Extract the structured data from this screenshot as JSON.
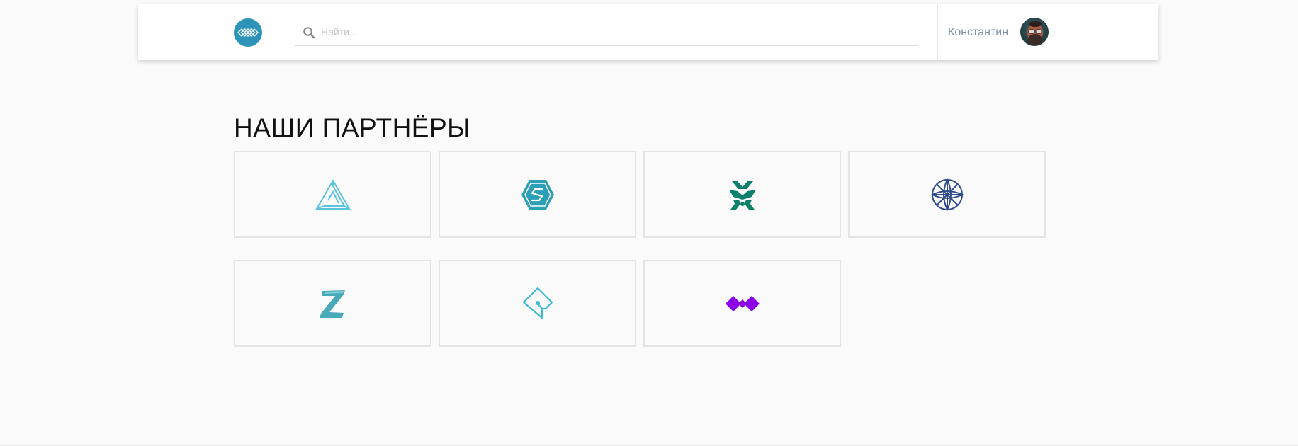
{
  "header": {
    "logo_icon": "diamonds-logo-icon",
    "search": {
      "placeholder": "Найти...",
      "value": "",
      "icon": "search-icon"
    },
    "user": {
      "name": "Константин",
      "avatar_icon": "user-avatar"
    }
  },
  "main": {
    "title": "НАШИ ПАРТНЁРЫ",
    "partners": [
      {
        "icon": "impossible-triangle-logo-icon",
        "color": "#5cc4dd"
      },
      {
        "icon": "hexagon-s-logo-icon",
        "color": "#2a9fb5"
      },
      {
        "icon": "tribal-figure-logo-icon",
        "color": "#0d7f6b"
      },
      {
        "icon": "circle-wheel-logo-icon",
        "color": "#2f4b8a"
      },
      {
        "icon": "letter-z-logo-icon",
        "color": "#48a9b8"
      },
      {
        "icon": "diamond-pin-logo-icon",
        "color": "#3cbad6"
      },
      {
        "icon": "double-diamond-logo-icon",
        "color": "#8b00e6"
      }
    ]
  },
  "colors": {
    "background": "#fafafa",
    "header_bg": "#ffffff",
    "brand": "#2e93b8",
    "user_name": "#8290a8"
  }
}
